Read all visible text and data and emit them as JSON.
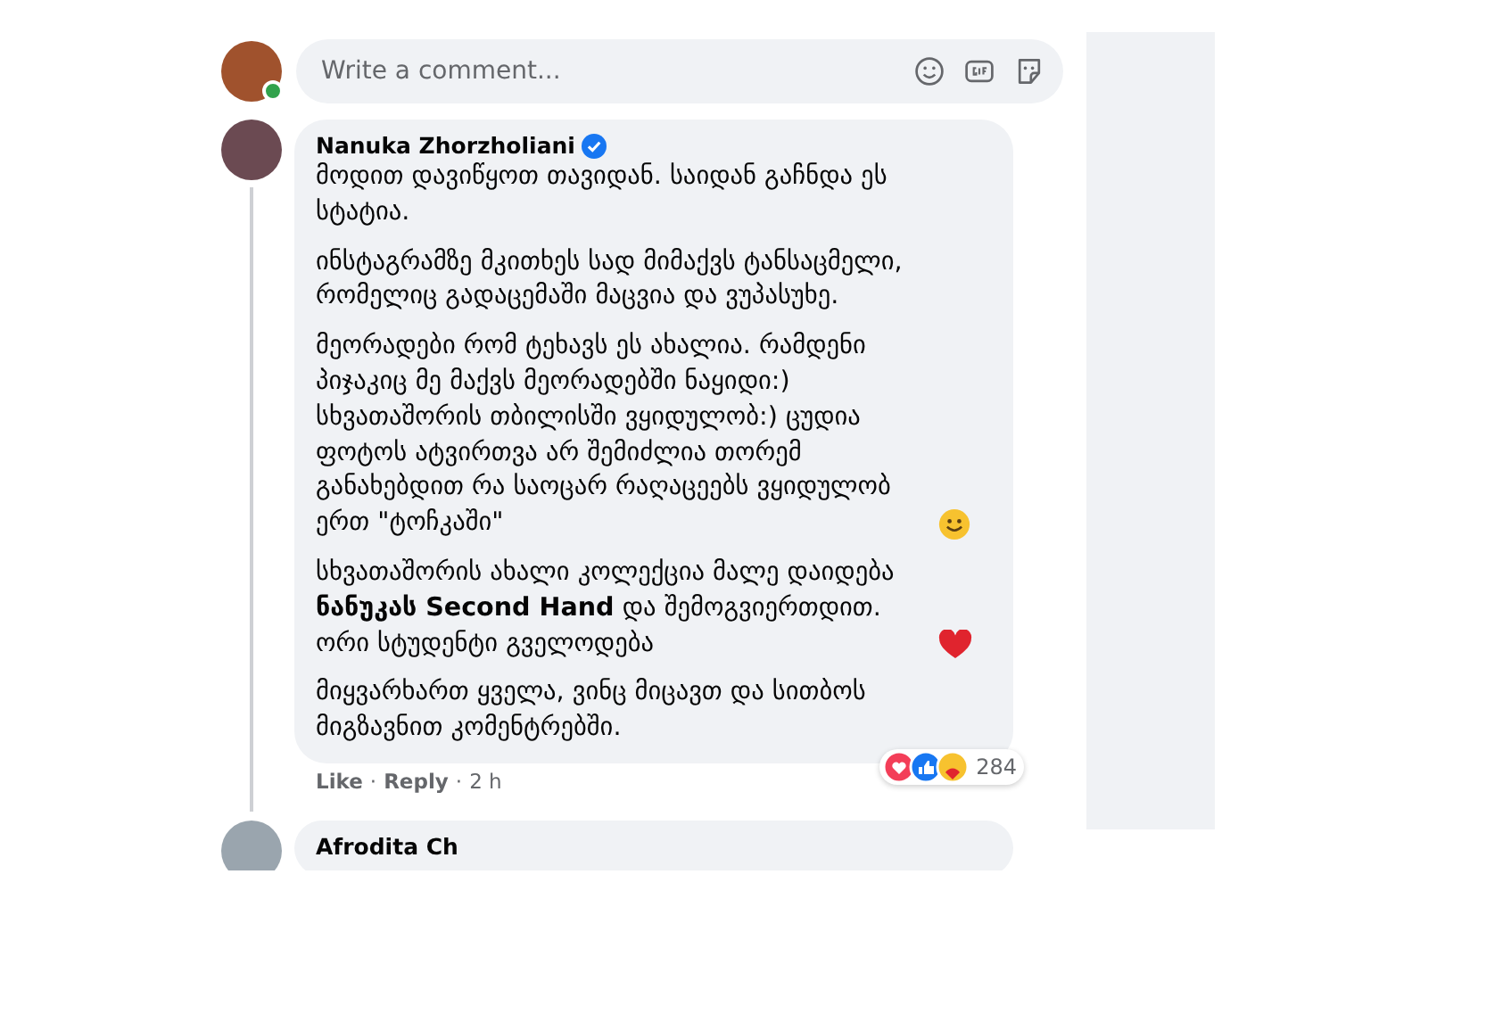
{
  "composer": {
    "placeholder": "Write a comment...",
    "online": true
  },
  "comments": [
    {
      "author": "Nanuka Zhorzholiani",
      "verified": true,
      "paragraphs": [
        {
          "kind": "plain",
          "text": "მოდით დავიწყოთ თავიდან. საიდან გაჩნდა ეს სტატია."
        },
        {
          "kind": "plain",
          "text": "ინსტაგრამზე მკითხეს სად მიმაქვს ტანსაცმელი, რომელიც გადაცემაში მაცვია და ვუპასუხე."
        },
        {
          "text": "მეორადები რომ ტეხავს ეს ახალია. რამდენი პიჯაკიც მე მაქვს მეორადებში ნაყიდი:) სხვათაშორის თბილისში ვყიდულობ:) ცუდია ფოტოს ატვირთვა არ შემიძლია თორემ განახებდით რა საოცარ რაღაცეებს ვყიდულობ ერთ \"ტოჩკაში\"",
          "kind": "smiley"
        },
        {
          "text": "სხვათაშორის ახალი კოლექცია მალე დაიდება **ნანუკას Second Hand** და შემოგვიერთდით. ორი სტუდენტი გველოდება",
          "kind": "heart"
        },
        {
          "kind": "plain",
          "text": "მიყვარხართ ყველა, ვინც მიცავთ და სითბოს მიგზავნით კომენტრებში."
        }
      ],
      "footer": [
        {
          "kind": "link",
          "text": "Like"
        },
        {
          "kind": "sep",
          "text": "·"
        },
        {
          "kind": "link",
          "text": "Reply"
        },
        {
          "kind": "sep",
          "text": "·"
        },
        {
          "kind": "time",
          "text": "2 h"
        }
      ],
      "reaction_count": "284"
    },
    {
      "author": "Afrodita Ch"
    }
  ]
}
